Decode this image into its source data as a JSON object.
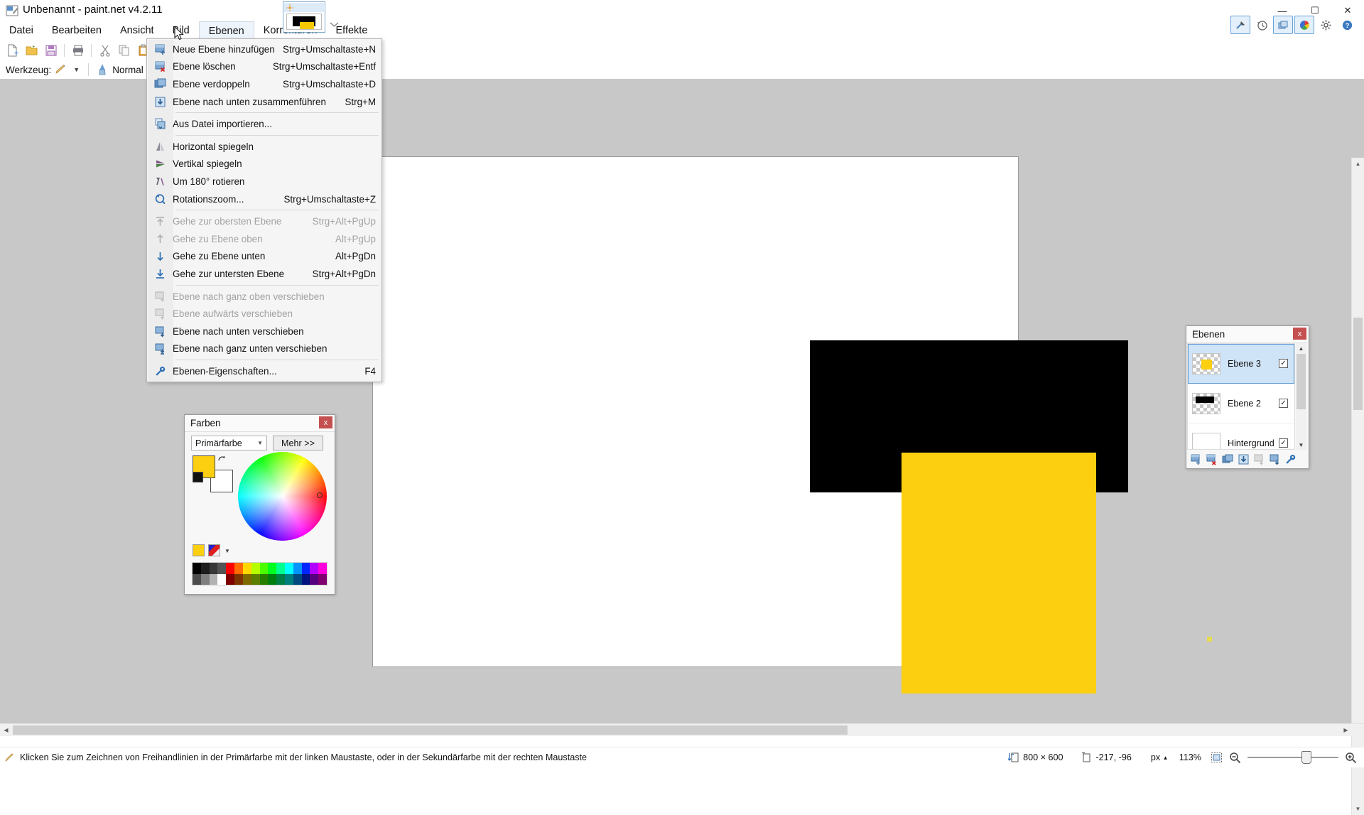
{
  "window": {
    "title": "Unbenannt - paint.net v4.2.11",
    "minimize": "—",
    "maximize": "☐",
    "close": "✕"
  },
  "menubar": {
    "items": [
      {
        "label": "Datei",
        "open": false
      },
      {
        "label": "Bearbeiten",
        "open": false
      },
      {
        "label": "Ansicht",
        "open": false
      },
      {
        "label": "Bild",
        "open": false
      },
      {
        "label": "Ebenen",
        "open": true
      },
      {
        "label": "Korrekturen",
        "open": false
      },
      {
        "label": "Effekte",
        "open": false
      }
    ]
  },
  "toolbar": {
    "icons": [
      {
        "name": "new-icon"
      },
      {
        "name": "open-icon"
      },
      {
        "name": "save-icon"
      },
      {
        "name": "print-icon"
      },
      {
        "name": "cut-icon"
      },
      {
        "name": "copy-icon"
      },
      {
        "name": "paste-icon"
      },
      {
        "name": "crop-icon"
      }
    ]
  },
  "toolrow": {
    "tool_label": "Werkzeug:",
    "blend_label": "Normal"
  },
  "header_icons": [
    {
      "name": "tools-icon",
      "active": false
    },
    {
      "name": "history-icon",
      "active": false
    },
    {
      "name": "layers-icon",
      "active": true
    },
    {
      "name": "colors-icon",
      "active": true
    },
    {
      "name": "settings-icon",
      "active": false
    },
    {
      "name": "help-icon",
      "active": false
    }
  ],
  "menu_ebenen": {
    "items": [
      {
        "label": "Neue Ebene hinzufügen",
        "shortcut": "Strg+Umschaltaste+N",
        "disabled": false,
        "icon": "layer-add-icon",
        "sep_after": false
      },
      {
        "label": "Ebene löschen",
        "shortcut": "Strg+Umschaltaste+Entf",
        "disabled": false,
        "icon": "layer-delete-icon",
        "sep_after": false
      },
      {
        "label": "Ebene verdoppeln",
        "shortcut": "Strg+Umschaltaste+D",
        "disabled": false,
        "icon": "layer-duplicate-icon",
        "sep_after": false
      },
      {
        "label": "Ebene nach unten zusammenführen",
        "shortcut": "Strg+M",
        "disabled": false,
        "icon": "layer-merge-down-icon",
        "sep_after": true
      },
      {
        "label": "Aus Datei importieren...",
        "shortcut": "",
        "disabled": false,
        "icon": "import-file-icon",
        "sep_after": true
      },
      {
        "label": "Horizontal spiegeln",
        "shortcut": "",
        "disabled": false,
        "icon": "flip-horizontal-icon",
        "sep_after": false
      },
      {
        "label": "Vertikal spiegeln",
        "shortcut": "",
        "disabled": false,
        "icon": "flip-vertical-icon",
        "sep_after": false
      },
      {
        "label": "Um 180° rotieren",
        "shortcut": "",
        "disabled": false,
        "icon": "rotate-180-icon",
        "sep_after": false
      },
      {
        "label": "Rotationszoom...",
        "shortcut": "Strg+Umschaltaste+Z",
        "disabled": false,
        "icon": "rotate-zoom-icon",
        "sep_after": true
      },
      {
        "label": "Gehe zur obersten Ebene",
        "shortcut": "Strg+Alt+PgUp",
        "disabled": true,
        "icon": "goto-top-layer-icon",
        "sep_after": false
      },
      {
        "label": "Gehe zu Ebene oben",
        "shortcut": "Alt+PgUp",
        "disabled": true,
        "icon": "goto-layer-up-icon",
        "sep_after": false
      },
      {
        "label": "Gehe zu Ebene unten",
        "shortcut": "Alt+PgDn",
        "disabled": false,
        "icon": "goto-layer-down-icon",
        "sep_after": false
      },
      {
        "label": "Gehe zur untersten Ebene",
        "shortcut": "Strg+Alt+PgDn",
        "disabled": false,
        "icon": "goto-bottom-layer-icon",
        "sep_after": true
      },
      {
        "label": "Ebene nach ganz oben verschieben",
        "shortcut": "",
        "disabled": true,
        "icon": "move-layer-top-icon",
        "sep_after": false
      },
      {
        "label": "Ebene aufwärts verschieben",
        "shortcut": "",
        "disabled": true,
        "icon": "move-layer-up-icon",
        "sep_after": false
      },
      {
        "label": "Ebene nach unten verschieben",
        "shortcut": "",
        "disabled": false,
        "icon": "move-layer-down-icon",
        "sep_after": false
      },
      {
        "label": "Ebene nach ganz unten verschieben",
        "shortcut": "",
        "disabled": false,
        "icon": "move-layer-bottom-icon",
        "sep_after": true
      },
      {
        "label": "Ebenen-Eigenschaften...",
        "shortcut": "F4",
        "disabled": false,
        "icon": "layer-properties-icon",
        "sep_after": false
      }
    ]
  },
  "farben_panel": {
    "title": "Farben",
    "close": "x",
    "mode_value": "Primärfarbe",
    "more_label": "Mehr >>",
    "primary_color": "#fccf10",
    "secondary_color": "#ffffff",
    "palette_row1": [
      "#000000",
      "#1c1c1c",
      "#383838",
      "#545454",
      "#ff0000",
      "#ff6a00",
      "#ffd800",
      "#b6ff00",
      "#4cff00",
      "#00ff21",
      "#00ff90",
      "#00ffff",
      "#0094ff",
      "#0026ff",
      "#b200ff",
      "#ff00dc"
    ],
    "palette_row2": [
      "#4c4c4c",
      "#7f7f7f",
      "#b2b2b2",
      "#ffffff",
      "#7f0000",
      "#7f3300",
      "#7f6a00",
      "#5b7f00",
      "#267f00",
      "#007f0e",
      "#007f46",
      "#007f7f",
      "#004a7f",
      "#00137f",
      "#57007f",
      "#7f006e"
    ]
  },
  "ebenen_panel": {
    "title": "Ebenen",
    "close": "x",
    "layers": [
      {
        "name": "Ebene 3",
        "visible": true,
        "selected": true,
        "thumb": "yellow"
      },
      {
        "name": "Ebene 2",
        "visible": true,
        "selected": false,
        "thumb": "black"
      },
      {
        "name": "Hintergrund",
        "visible": true,
        "selected": false,
        "thumb": "white"
      }
    ],
    "check_glyph": "✓",
    "tools": [
      {
        "name": "layer-add-button"
      },
      {
        "name": "layer-delete-button"
      },
      {
        "name": "layer-duplicate-button"
      },
      {
        "name": "layer-merge-down-button"
      },
      {
        "name": "layer-move-up-button"
      },
      {
        "name": "layer-move-down-button"
      },
      {
        "name": "layer-properties-button"
      }
    ]
  },
  "statusbar": {
    "hint": "Klicken Sie zum Zeichnen von Freihandlinien in der Primärfarbe mit der linken Maustaste, oder in der Sekundärfarbe mit der rechten Maustaste",
    "image_size": "800 × 600",
    "cursor_position": "-217, -96",
    "unit": "px",
    "zoom_level": "113%",
    "unit_caret": "▴"
  },
  "document_tab": {
    "name": "document-thumbnail"
  }
}
